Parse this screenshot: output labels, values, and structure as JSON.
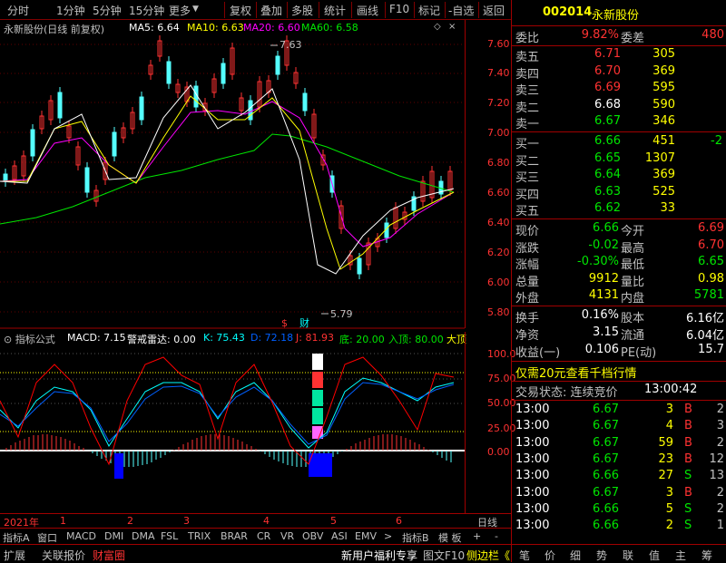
{
  "toolbar": {
    "periods": [
      "分时",
      "1分钟",
      "5分钟",
      "15分钟",
      "更多"
    ],
    "tools": [
      "复权",
      "叠加",
      "多股",
      "统计",
      "画线",
      "F10",
      "标记",
      "-自选",
      "返回"
    ]
  },
  "chart_header": {
    "stock": "永新股份(日线 前复权)",
    "ma5": "MA5: 6.64",
    "ma10": "MA10: 6.63",
    "ma20": "MA20: 6.60",
    "ma60": "MA60: 6.58"
  },
  "price_axis": [
    "7.60",
    "7.40",
    "7.20",
    "7.00",
    "6.80",
    "6.60",
    "6.40",
    "6.20",
    "6.00",
    "5.80"
  ],
  "annotations": {
    "high": "7.63",
    "low": "5.79",
    "markers": [
      "$",
      "财"
    ]
  },
  "indicator_header": {
    "title": "指标公式",
    "macd": "MACD: 7.15",
    "radar": "警戒雷达: 0.00",
    "k": "K: 75.43",
    "d": "D: 72.18",
    "j": "J: 81.93",
    "bottom": "底: 20.00",
    "top": "入顶: 80.00",
    "big": "大顶"
  },
  "indicator_axis": [
    "100.0",
    "75.00",
    "50.00",
    "25.00",
    "0.00"
  ],
  "date_axis": {
    "year": "2021年",
    "months": [
      "1",
      "2",
      "3",
      "4",
      "5",
      "6"
    ],
    "period": "日线"
  },
  "indicator_tabs": [
    "指标A",
    "窗口",
    "MACD",
    "DMI",
    "DMA",
    "FSL",
    "TRIX",
    "BRAR",
    "CR",
    "VR",
    "OBV",
    "ASI",
    "EMV",
    ">",
    "指标B",
    "模 板",
    "+",
    "-"
  ],
  "status_bar": {
    "left": [
      "扩展",
      "关联报价",
      "财富圈"
    ],
    "promo": "新用户福利专享",
    "right": [
      "图文F10",
      "侧边栏《"
    ],
    "icons": [
      "笔",
      "价",
      "细",
      "势",
      "联",
      "值",
      "主",
      "筹"
    ]
  },
  "quote": {
    "code": "002014",
    "name": "永新股份",
    "weibi_label": "委比",
    "weibi": "9.82%",
    "weicha_label": "委差",
    "weicha": "480",
    "sells": [
      {
        "label": "卖五",
        "price": "6.71",
        "vol": "305"
      },
      {
        "label": "卖四",
        "price": "6.70",
        "vol": "369"
      },
      {
        "label": "卖三",
        "price": "6.69",
        "vol": "595"
      },
      {
        "label": "卖二",
        "price": "6.68",
        "vol": "590"
      },
      {
        "label": "卖一",
        "price": "6.67",
        "vol": "346"
      }
    ],
    "buys": [
      {
        "label": "买一",
        "price": "6.66",
        "vol": "451",
        "chg": "-2"
      },
      {
        "label": "买二",
        "price": "6.65",
        "vol": "1307",
        "chg": ""
      },
      {
        "label": "买三",
        "price": "6.64",
        "vol": "369",
        "chg": ""
      },
      {
        "label": "买四",
        "price": "6.63",
        "vol": "525",
        "chg": ""
      },
      {
        "label": "买五",
        "price": "6.62",
        "vol": "33",
        "chg": ""
      }
    ],
    "stats": [
      {
        "l1": "现价",
        "v1": "6.66",
        "l2": "今开",
        "v2": "6.69"
      },
      {
        "l1": "涨跌",
        "v1": "-0.02",
        "l2": "最高",
        "v2": "6.70"
      },
      {
        "l1": "涨幅",
        "v1": "-0.30%",
        "l2": "最低",
        "v2": "6.65"
      },
      {
        "l1": "总量",
        "v1": "9912",
        "l2": "量比",
        "v2": "0.98"
      },
      {
        "l1": "外盘",
        "v1": "4131",
        "l2": "内盘",
        "v2": "5781"
      }
    ],
    "stats2": [
      {
        "l1": "换手",
        "v1": "0.16%",
        "l2": "股本",
        "v2": "6.16亿"
      },
      {
        "l1": "净资",
        "v1": "3.15",
        "l2": "流通",
        "v2": "6.04亿"
      },
      {
        "l1": "收益(一)",
        "v1": "0.106",
        "l2": "PE(动)",
        "v2": "15.7"
      }
    ],
    "promo": "仅需20元查看千档行情",
    "state_label": "交易状态: 连续竞价",
    "state_time": "13:00:42",
    "ticks": [
      {
        "t": "13:00",
        "p": "6.67",
        "v": "3",
        "bs": "B",
        "n": "2"
      },
      {
        "t": "13:00",
        "p": "6.67",
        "v": "4",
        "bs": "B",
        "n": "3"
      },
      {
        "t": "13:00",
        "p": "6.67",
        "v": "59",
        "bs": "B",
        "n": "2"
      },
      {
        "t": "13:00",
        "p": "6.67",
        "v": "23",
        "bs": "B",
        "n": "12"
      },
      {
        "t": "13:00",
        "p": "6.66",
        "v": "27",
        "bs": "S",
        "n": "13"
      },
      {
        "t": "13:00",
        "p": "6.67",
        "v": "3",
        "bs": "B",
        "n": "2"
      },
      {
        "t": "13:00",
        "p": "6.66",
        "v": "5",
        "bs": "S",
        "n": "2"
      },
      {
        "t": "13:00",
        "p": "6.66",
        "v": "2",
        "bs": "S",
        "n": "1"
      }
    ]
  },
  "colors": {
    "up": "#ff3232",
    "down": "#00e600",
    "ma5": "#ffffff",
    "ma10": "#ffff00",
    "ma20": "#ff00ff",
    "ma60": "#00e600",
    "frame": "#a00000"
  }
}
